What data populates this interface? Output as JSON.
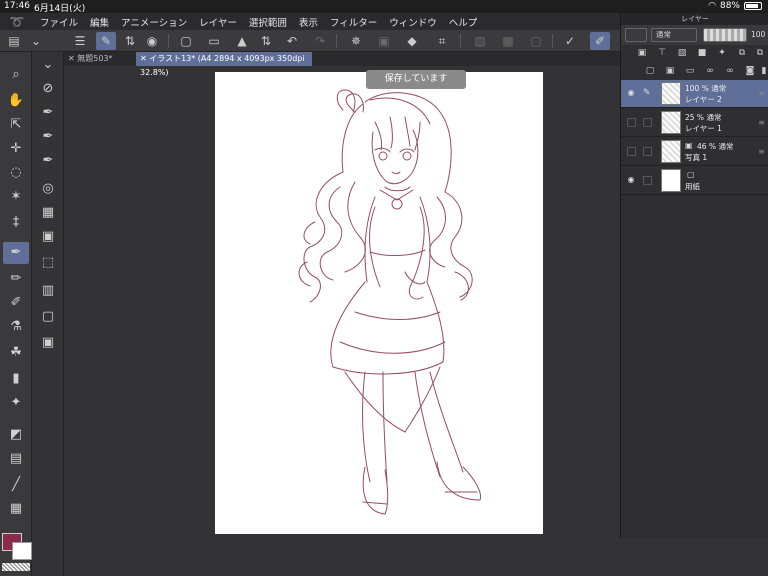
{
  "status": {
    "time": "17:46",
    "date": "6月14日(火)",
    "battery": "88%",
    "battery_level": 0.88
  },
  "menu": [
    "ファイル",
    "編集",
    "アニメーション",
    "レイヤー",
    "選択範囲",
    "表示",
    "フィルター",
    "ウィンドウ",
    "ヘルプ"
  ],
  "tabs": [
    {
      "label": "無題503*",
      "active": false
    },
    {
      "label": "イラスト13* (A4 2894 x 4093px 350dpi 32.8%)",
      "active": true
    }
  ],
  "save_status": "保存しています",
  "colors": {
    "main": "#8b2a4a",
    "sub": "#ffffff",
    "accent": "#5f6f98",
    "stroke": "#8b3a52"
  },
  "layer_panel": {
    "title": "レイヤー",
    "blend_mode": "通常",
    "opacity": "100",
    "layers": [
      {
        "opacity_mode": "100 % 通常",
        "name": "レイヤー 2",
        "selected": true,
        "visible": true,
        "thumb": "transparent"
      },
      {
        "opacity_mode": "25 % 通常",
        "name": "レイヤー 1",
        "selected": false,
        "visible": false,
        "thumb": "transparent"
      },
      {
        "opacity_mode": "46 % 通常",
        "name": "写真 1",
        "selected": false,
        "visible": false,
        "thumb": "transparent"
      },
      {
        "opacity_mode": "",
        "name": "用紙",
        "selected": false,
        "visible": true,
        "thumb": "white"
      }
    ]
  }
}
